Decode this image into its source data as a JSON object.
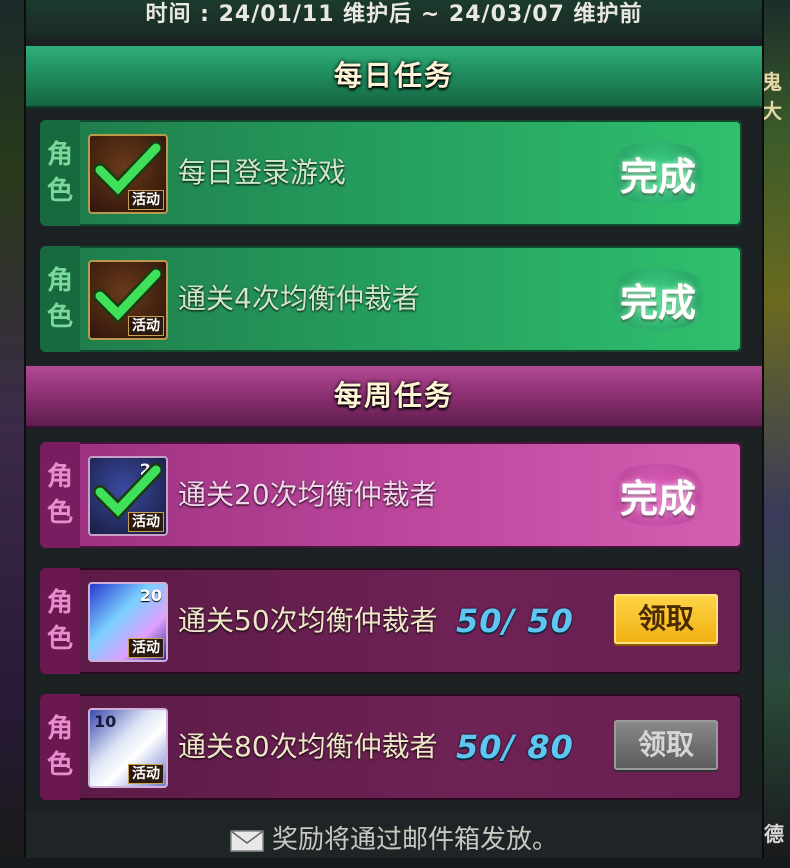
{
  "period": "时间 : 24/01/11 维护后 ~ 24/03/07 维护前",
  "sections": {
    "daily_title": "每日任务",
    "weekly_title": "每周任务"
  },
  "tag": {
    "char1": "角",
    "char2": "色"
  },
  "icon_badge": "活动",
  "tasks": [
    {
      "name": "每日登录游戏",
      "status": "完成"
    },
    {
      "name": "通关4次均衡仲裁者",
      "status": "完成"
    },
    {
      "name": "通关20次均衡仲裁者",
      "status": "完成",
      "icon_number": "20"
    },
    {
      "name": "通关50次均衡仲裁者",
      "progress": "50/ 50",
      "button": "领取",
      "icon_number": "20"
    },
    {
      "name": "通关80次均衡仲裁者",
      "progress": "50/ 80",
      "button": "领取",
      "icon_number": "10"
    }
  ],
  "footer": "奖励将通过邮件箱发放。",
  "edge_text": {
    "right_top": "鬼大",
    "right_bottom": "德"
  },
  "colors": {
    "daily": "#26a260",
    "weekly": "#8c2f72",
    "progress": "#5ec6f0",
    "claim_active": "#f0b010",
    "claim_disabled": "#6a6a6a"
  },
  "icons": [
    "checkmark-icon",
    "mail-icon"
  ]
}
